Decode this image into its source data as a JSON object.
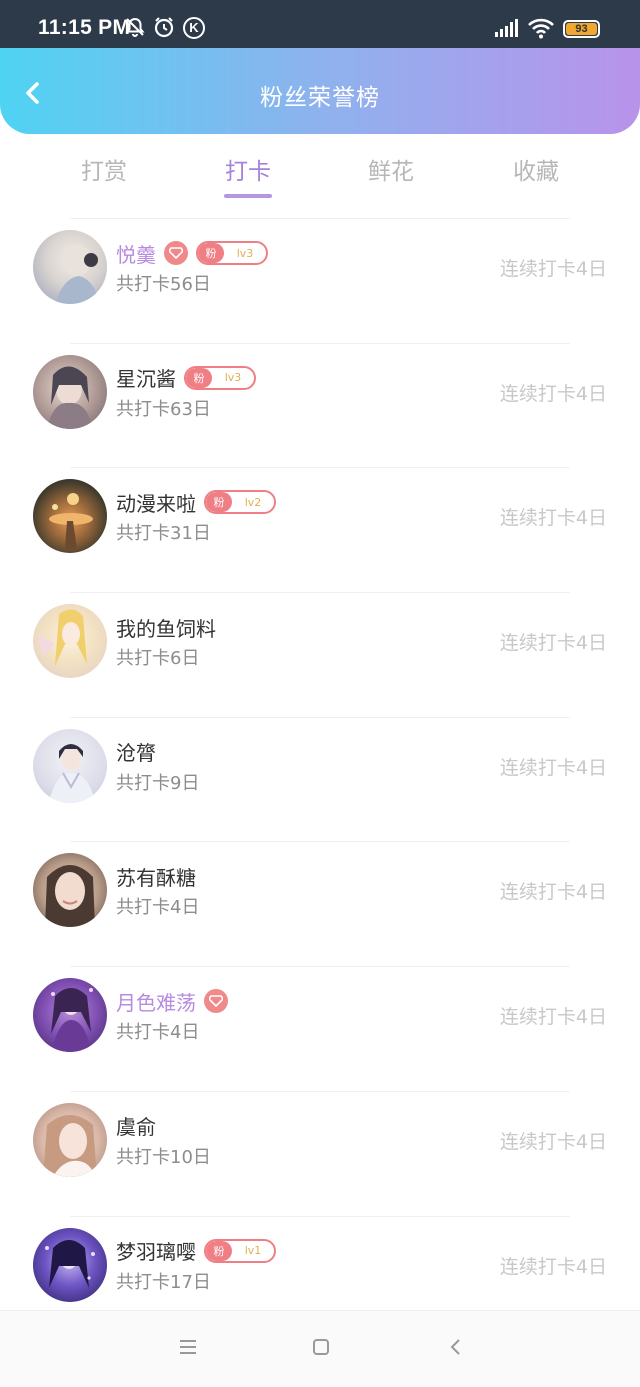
{
  "status_bar": {
    "time": "11:15 PM",
    "battery": "93"
  },
  "header": {
    "title": "粉丝荣誉榜"
  },
  "tabs": [
    {
      "label": "打赏"
    },
    {
      "label": "打卡"
    },
    {
      "label": "鲜花"
    },
    {
      "label": "收藏"
    }
  ],
  "active_tab": "打卡",
  "accent_colors": {
    "header_start": "#4fd3f2",
    "header_end": "#b893ea",
    "tab_active": "#a583d9",
    "vip_name": "#b78be0",
    "badge": "#ef7f84"
  },
  "fans": [
    {
      "name": "悦羹",
      "vip": true,
      "diamond": true,
      "badge": {
        "label": "粉",
        "level": "lv3"
      },
      "total": "共打卡56日",
      "streak": "连续打卡4日"
    },
    {
      "name": "星沉酱",
      "vip": false,
      "diamond": false,
      "badge": {
        "label": "粉",
        "level": "lv3"
      },
      "total": "共打卡63日",
      "streak": "连续打卡4日"
    },
    {
      "name": "动漫来啦",
      "vip": false,
      "diamond": false,
      "badge": {
        "label": "粉",
        "level": "lv2"
      },
      "total": "共打卡31日",
      "streak": "连续打卡4日"
    },
    {
      "name": "我的鱼饲料",
      "vip": false,
      "diamond": false,
      "badge": null,
      "total": "共打卡6日",
      "streak": "连续打卡4日"
    },
    {
      "name": "沧膂",
      "vip": false,
      "diamond": false,
      "badge": null,
      "total": "共打卡9日",
      "streak": "连续打卡4日"
    },
    {
      "name": "苏有酥糖",
      "vip": false,
      "diamond": false,
      "badge": null,
      "total": "共打卡4日",
      "streak": "连续打卡4日"
    },
    {
      "name": "月色难荡",
      "vip": true,
      "diamond": true,
      "badge": null,
      "total": "共打卡4日",
      "streak": "连续打卡4日"
    },
    {
      "name": "虞俞",
      "vip": false,
      "diamond": false,
      "badge": null,
      "total": "共打卡10日",
      "streak": "连续打卡4日"
    },
    {
      "name": "梦羽璃嘤",
      "vip": false,
      "diamond": false,
      "badge": {
        "label": "粉",
        "level": "lv1"
      },
      "total": "共打卡17日",
      "streak": "连续打卡4日"
    }
  ]
}
